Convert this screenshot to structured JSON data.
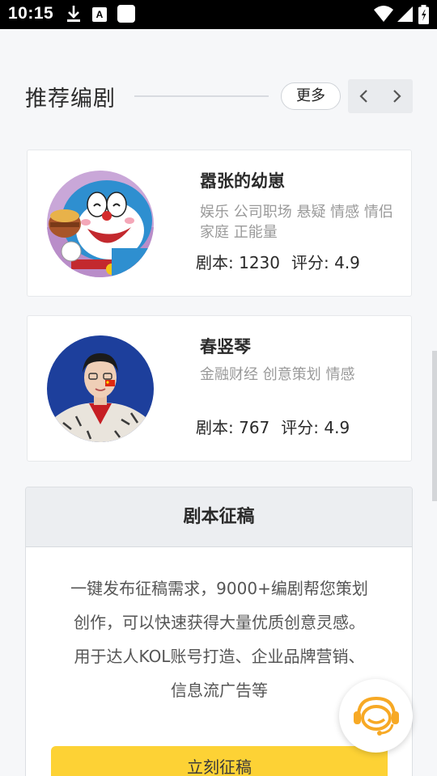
{
  "status_bar": {
    "time": "10:15",
    "icons": [
      "download-icon",
      "a-icon",
      "square-icon",
      "wifi-icon",
      "signal-icon",
      "battery-icon"
    ],
    "a_label": "A"
  },
  "section": {
    "title": "推荐编剧",
    "more_label": "更多"
  },
  "writers": [
    {
      "name": "嚣张的幼崽",
      "tags": "娱乐 公司职场 悬疑 情感 情侣 家庭 正能量",
      "scripts": "剧本: 1230",
      "rating": "评分: 4.9",
      "avatar": "cartoon-cat-avatar"
    },
    {
      "name": "春竖琴",
      "tags": "金融财经 创意策划 情感",
      "scripts": "剧本: 767",
      "rating": "评分: 4.9",
      "avatar": "person-photo-avatar"
    }
  ],
  "panel": {
    "title": "剧本征稿",
    "lines": [
      "一键发布征稿需求，9000+编剧帮您策划",
      "创作，可以快速获得大量优质创意灵感。",
      "用于达人KOL账号打造、企业品牌营销、",
      "信息流广告等"
    ],
    "cta_label": "立刻征稿"
  },
  "colors": {
    "accent_yellow": "#fdd235",
    "fab_orange": "#f7a925"
  }
}
